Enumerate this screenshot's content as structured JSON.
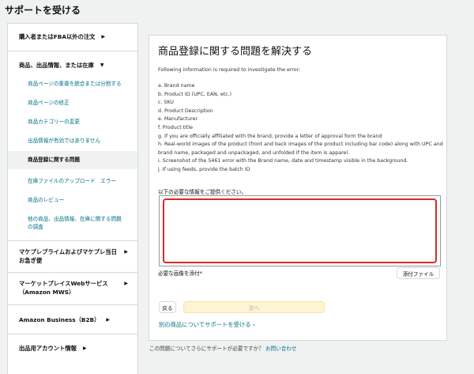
{
  "page": {
    "title": "サポートを受ける"
  },
  "sidebar": {
    "cat_buyer": "購入者またはFBA以外の注文",
    "cat_product": "商品、出品情報、または在庫",
    "sub_items": [
      "商品ページの重複を統合または分割する",
      "商品ページの修正",
      "商品カテゴリーの変更",
      "出品情報が有効ではありません",
      "商品登録に関する問題",
      "在庫ファイルのアップロード　エラー",
      "商品のレビュー",
      "他の商品、出品情報、在庫に関する問題の調査"
    ],
    "cat_prime": "マケプレプライムおよびマケプレ当日お急ぎ便",
    "cat_mws": "マーケットプレイスWebサービス（Amazon MWS）",
    "cat_b2b": "Amazon Business（B2B）",
    "cat_account": "出品用アカウント情報"
  },
  "panel": {
    "title": "商品登録に関する問題を解決する",
    "intro": "Following information is required to investigate the error:",
    "items": [
      "a. Brand name",
      "b. Product ID (UPC, EAN, etc.)",
      "c. SKU",
      "d. Product Description",
      "e. Manufacturer",
      "f. Product title",
      "g. If you are officially affiliated with the brand, provide a letter of approval form the brand",
      "h. Real-world images of the product (front and back images of the product including bar code) along with UPC and brand name, packaged and unpackaged, and unfolded if the item is apparel.",
      "i. Screenshot of the 5461 error with the Brand name, date and timestamp visible in the background.",
      "j. If using feeds, provide the batch ID"
    ],
    "prompt": "以下の必要な情報をご提供ください。",
    "textarea_value": "",
    "attach_label": "必要な画像を添付*",
    "attach_button": "添付ファイル",
    "back_button": "戻る",
    "next_button": "次へ",
    "other_link": "別の商品についてサポートを受ける ›"
  },
  "bottom": {
    "text": "この問題についてさらにサポートが必要ですか？",
    "link": "お問い合わせ"
  }
}
